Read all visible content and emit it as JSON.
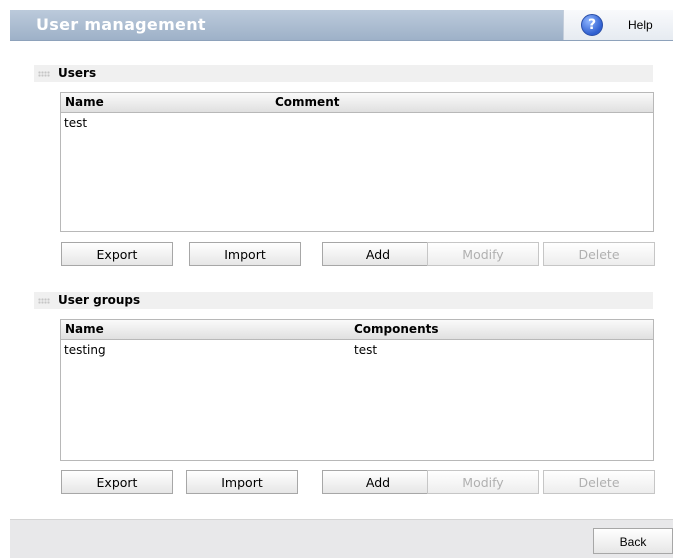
{
  "header": {
    "title": "User management",
    "help_label": "Help",
    "help_icon": "?"
  },
  "users": {
    "title": "Users",
    "columns": [
      "Name",
      "Comment"
    ],
    "rows": [
      [
        "test",
        ""
      ]
    ],
    "buttons": {
      "export": "Export",
      "import": "Import",
      "add": "Add",
      "modify": "Modify",
      "delete": "Delete"
    }
  },
  "groups": {
    "title": "User groups",
    "columns": [
      "Name",
      "Components"
    ],
    "rows": [
      [
        "testing",
        "test"
      ]
    ],
    "buttons": {
      "export": "Export",
      "import": "Import",
      "add": "Add",
      "modify": "Modify",
      "delete": "Delete"
    }
  },
  "footer": {
    "back_label": "Back"
  }
}
